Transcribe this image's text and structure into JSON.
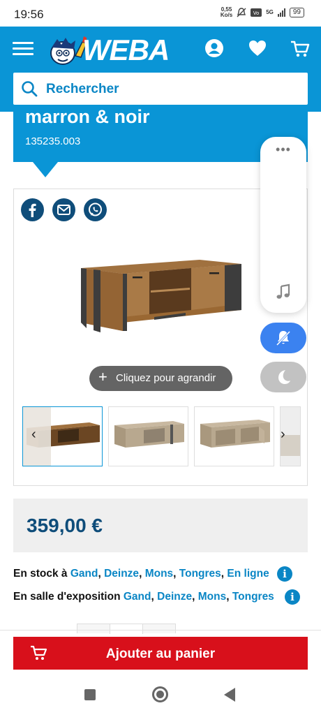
{
  "status_bar": {
    "time": "19:56",
    "net_speed_value": "0,55",
    "net_speed_unit": "Ko/s",
    "network_type": "5G",
    "battery": "99"
  },
  "header": {
    "brand": "WEBA",
    "search_placeholder": "Rechercher",
    "accent_color": "#0a95d6"
  },
  "product": {
    "title_line": "marron & noir",
    "reference": "135235.003",
    "zoom_label": "Cliquez pour agrandir",
    "share": [
      "facebook-icon",
      "mail-icon",
      "whatsapp-icon"
    ],
    "price": "359,00 €"
  },
  "availability": {
    "stock_label": "En stock à",
    "stock_locations": [
      "Gand",
      "Deinze",
      "Mons",
      "Tongres",
      "En ligne"
    ],
    "showroom_label": "En salle d'exposition",
    "showroom_locations": [
      "Gand",
      "Deinze",
      "Mons",
      "Tongres"
    ]
  },
  "cart": {
    "add_label": "Ajouter au panier",
    "button_color": "#d8101b"
  },
  "overlay": {
    "dots": "•••"
  }
}
